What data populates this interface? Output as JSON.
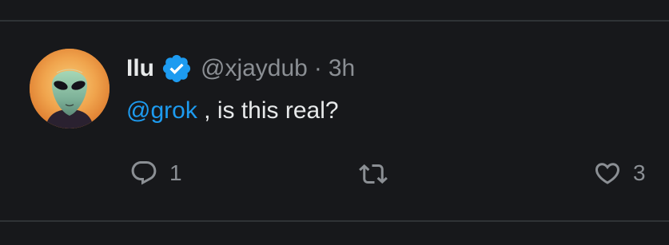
{
  "tweet": {
    "author_name": "Ilu",
    "handle": "@xjaydub",
    "separator": "·",
    "time": "3h",
    "mention": "@grok",
    "text_rest": " , is this real?"
  },
  "actions": {
    "reply_count": "1",
    "like_count": "3"
  },
  "icons": {
    "verified": "verified-badge-icon",
    "reply": "reply-bubble-icon",
    "retweet": "retweet-icon",
    "like": "heart-icon"
  },
  "colors": {
    "background": "#17181b",
    "text": "#e7e9ea",
    "muted": "#8b8f94",
    "link": "#1d9bf0",
    "divider": "#2f3336"
  }
}
